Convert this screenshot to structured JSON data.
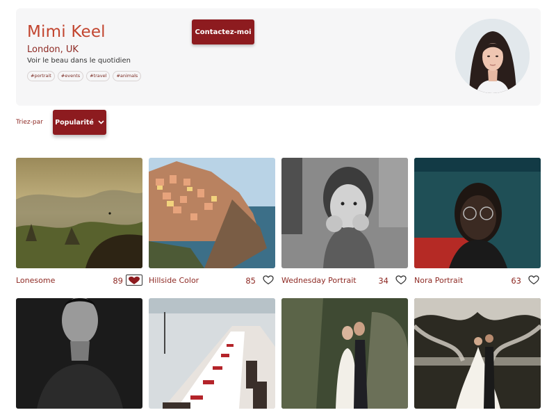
{
  "profile": {
    "name": "Mimi Keel",
    "location": "London, UK",
    "tagline": "Voir le beau dans le quotidien",
    "tags": [
      "#portrait",
      "#events",
      "#travel",
      "#animals"
    ],
    "contact_label": "Contactez-moi"
  },
  "sort": {
    "label": "Triez-par",
    "selected": "Popularité"
  },
  "photos": [
    {
      "title": "Lonesome",
      "likes": "89",
      "liked": true
    },
    {
      "title": "Hillside Color",
      "likes": "85",
      "liked": false
    },
    {
      "title": "Wednesday Portrait",
      "likes": "34",
      "liked": false
    },
    {
      "title": "Nora Portrait",
      "likes": "63",
      "liked": false
    },
    {
      "title": "",
      "likes": "",
      "liked": false
    },
    {
      "title": "",
      "likes": "",
      "liked": false
    },
    {
      "title": "",
      "likes": "",
      "liked": false
    },
    {
      "title": "",
      "likes": "",
      "liked": false
    }
  ],
  "colors": {
    "accent": "#8d1b1f",
    "name": "#c2452f",
    "text_accent": "#8e2a24",
    "card_bg": "#f6f6f7"
  }
}
